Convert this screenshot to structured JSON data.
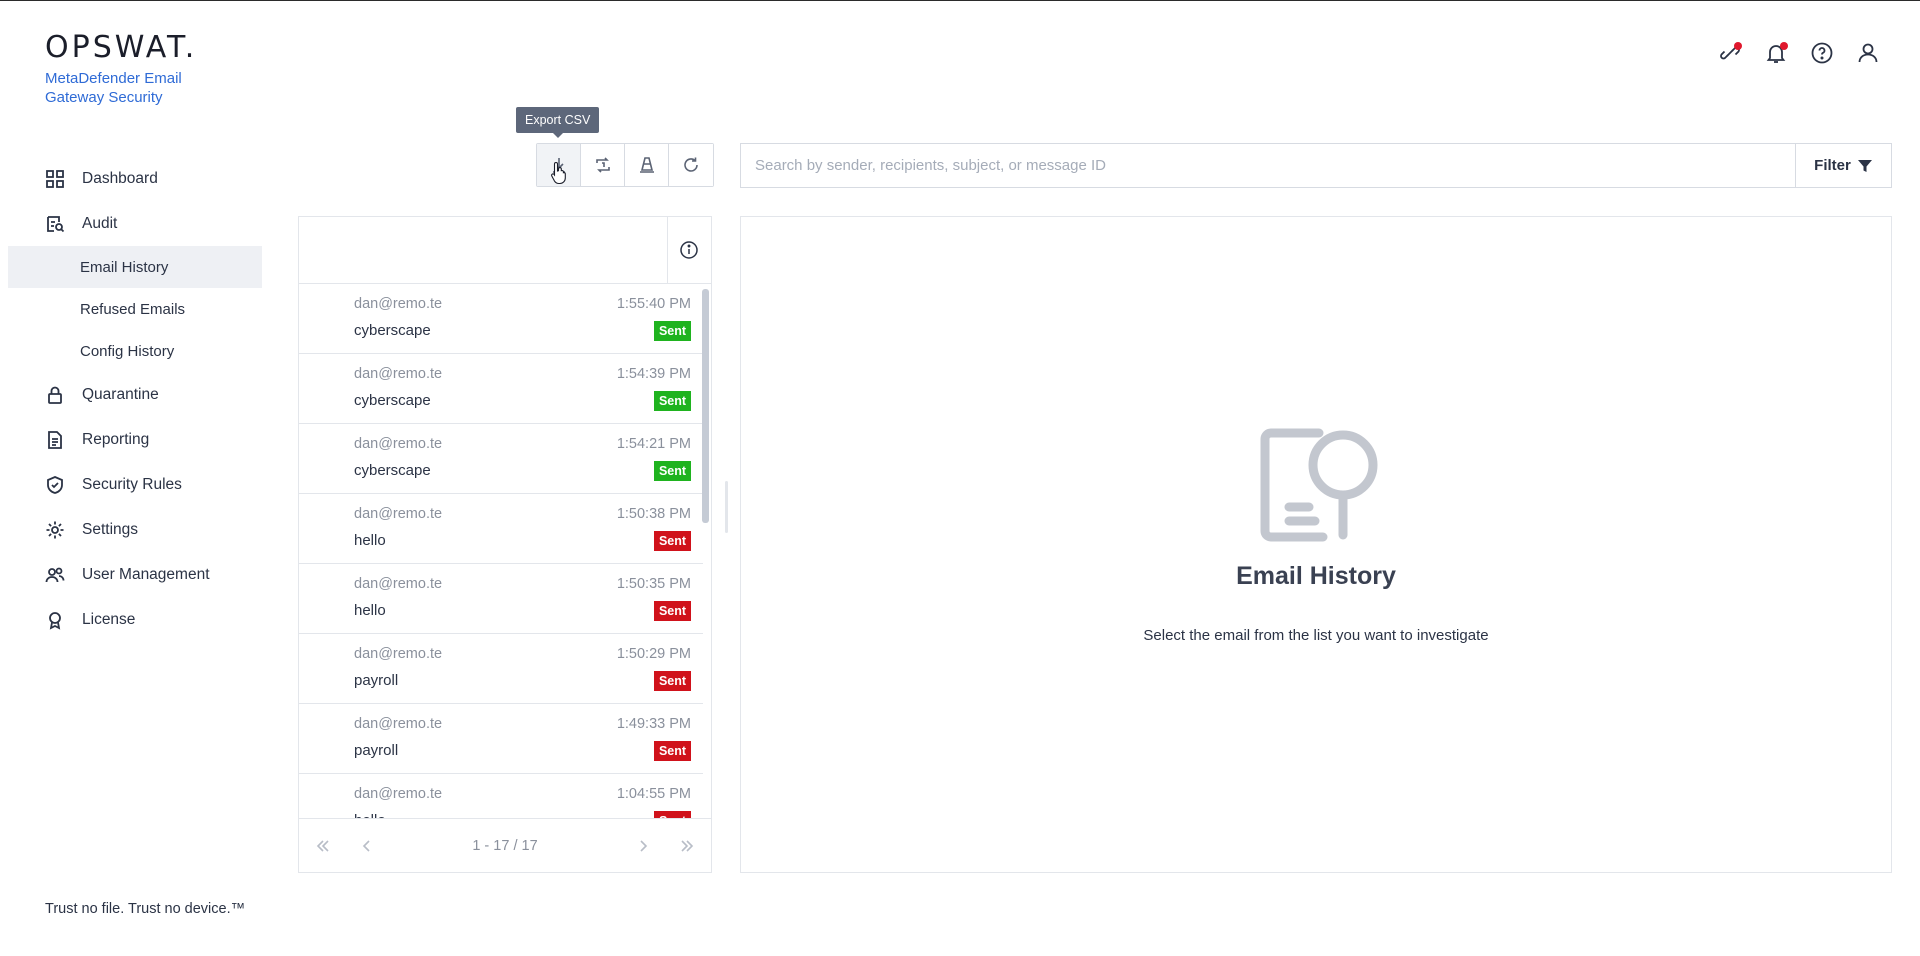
{
  "brand": {
    "logo": "OPSWAT.",
    "product": "MetaDefender Email Gateway Security",
    "tagline": "Trust no file. Trust no device.™"
  },
  "nav": {
    "dashboard": "Dashboard",
    "audit": "Audit",
    "email_history": "Email History",
    "refused_emails": "Refused Emails",
    "config_history": "Config History",
    "quarantine": "Quarantine",
    "reporting": "Reporting",
    "security_rules": "Security Rules",
    "settings": "Settings",
    "user_management": "User Management",
    "license": "License"
  },
  "toolbar": {
    "tooltip": "Export CSV",
    "buttons": [
      "download-icon",
      "reprocess-icon",
      "cone-icon",
      "refresh-icon"
    ]
  },
  "search": {
    "placeholder": "Search by sender, recipients, subject, or message ID",
    "value": "",
    "filter_label": "Filter"
  },
  "emails": [
    {
      "sender": "dan@remo.te",
      "time": "1:55:40 PM",
      "subject": "cyberscape",
      "status": "Sent",
      "status_color": "#1fb31f"
    },
    {
      "sender": "dan@remo.te",
      "time": "1:54:39 PM",
      "subject": "cyberscape",
      "status": "Sent",
      "status_color": "#1fb31f"
    },
    {
      "sender": "dan@remo.te",
      "time": "1:54:21 PM",
      "subject": "cyberscape",
      "status": "Sent",
      "status_color": "#1fb31f"
    },
    {
      "sender": "dan@remo.te",
      "time": "1:50:38 PM",
      "subject": "hello",
      "status": "Sent",
      "status_color": "#d0121b"
    },
    {
      "sender": "dan@remo.te",
      "time": "1:50:35 PM",
      "subject": "hello",
      "status": "Sent",
      "status_color": "#d0121b"
    },
    {
      "sender": "dan@remo.te",
      "time": "1:50:29 PM",
      "subject": "payroll",
      "status": "Sent",
      "status_color": "#d0121b"
    },
    {
      "sender": "dan@remo.te",
      "time": "1:49:33 PM",
      "subject": "payroll",
      "status": "Sent",
      "status_color": "#d0121b"
    },
    {
      "sender": "dan@remo.te",
      "time": "1:04:55 PM",
      "subject": "hello",
      "status": "Sent",
      "status_color": "#d0121b"
    }
  ],
  "pagination": {
    "text": "1 - 17 / 17"
  },
  "detail": {
    "title": "Email History",
    "subtitle": "Select the email from the list you want to investigate"
  },
  "colors": {
    "accent": "#2f6bd6",
    "sent_ok": "#1fb31f",
    "sent_threat": "#d0121b",
    "notification_dot": "#e0182d"
  }
}
